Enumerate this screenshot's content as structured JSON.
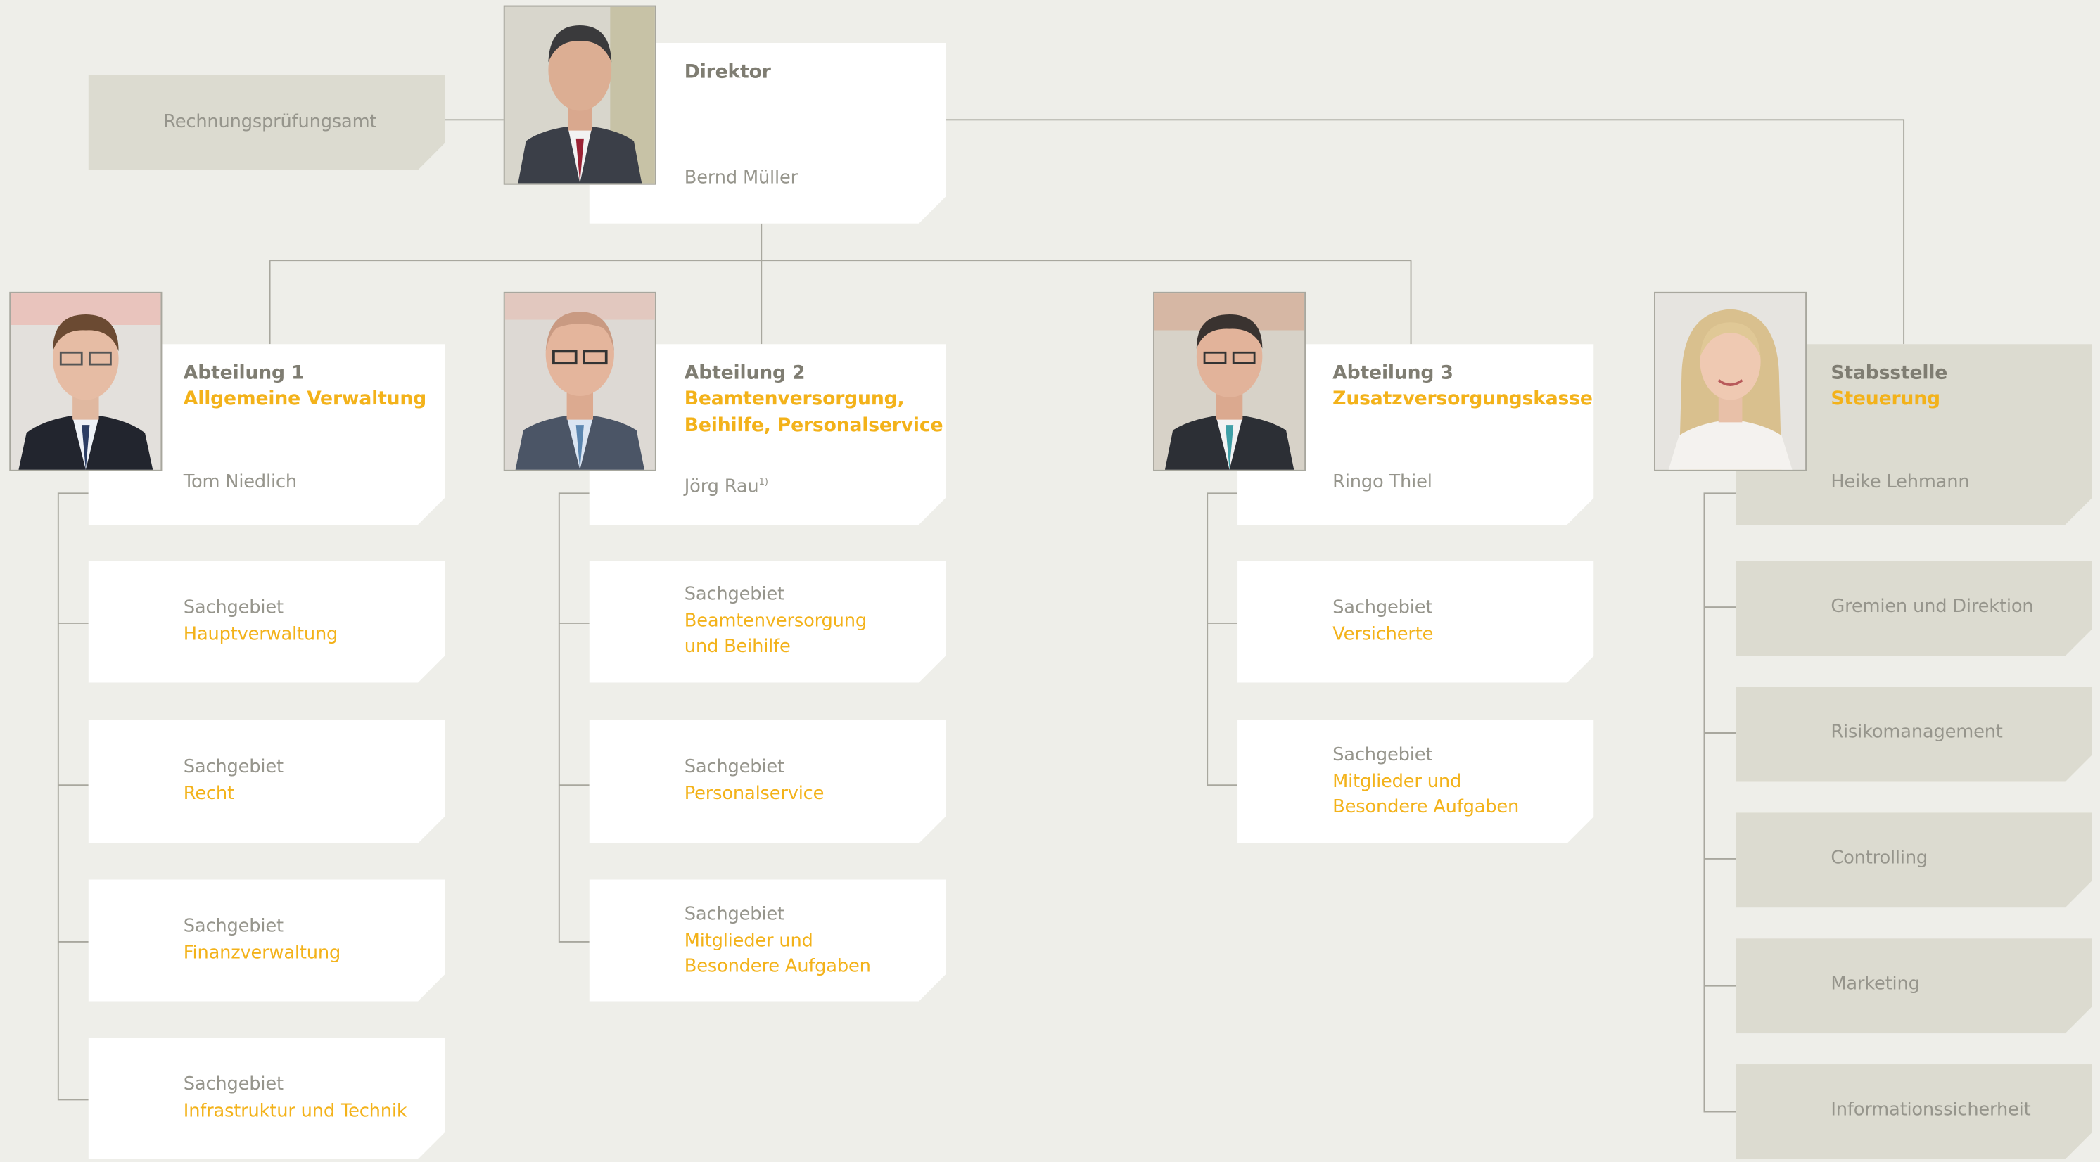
{
  "audit": {
    "label": "Rechnungsprüfungsamt"
  },
  "director": {
    "title": "Direktor",
    "name": "Bernd Müller"
  },
  "departments": [
    {
      "title": "Abteilung 1",
      "subtitle_lines": [
        "Allgemeine Verwaltung"
      ],
      "name": "Tom Niedlich",
      "name_note": ""
    },
    {
      "title": "Abteilung 2",
      "subtitle_lines": [
        "Beamtenversorgung,",
        "Beihilfe, Personalservice"
      ],
      "name": "Jörg Rau",
      "name_note": "1)"
    },
    {
      "title": "Abteilung 3",
      "subtitle_lines": [
        "Zusatzversorgungskasse"
      ],
      "name": "Ringo Thiel",
      "name_note": ""
    }
  ],
  "staff": {
    "title": "Stabsstelle",
    "subtitle": "Steuerung",
    "name": "Heike Lehmann"
  },
  "dept1_sections": [
    {
      "label": "Sachgebiet",
      "lines": [
        "Hauptverwaltung"
      ]
    },
    {
      "label": "Sachgebiet",
      "lines": [
        "Recht"
      ]
    },
    {
      "label": "Sachgebiet",
      "lines": [
        "Finanzverwaltung"
      ]
    },
    {
      "label": "Sachgebiet",
      "lines": [
        "Infrastruktur und Technik"
      ]
    }
  ],
  "dept2_sections": [
    {
      "label": "Sachgebiet",
      "lines": [
        "Beamtenversorgung",
        "und Beihilfe"
      ]
    },
    {
      "label": "Sachgebiet",
      "lines": [
        "Personalservice"
      ]
    },
    {
      "label": "Sachgebiet",
      "lines": [
        "Mitglieder und",
        "Besondere Aufgaben"
      ]
    }
  ],
  "dept3_sections": [
    {
      "label": "Sachgebiet",
      "lines": [
        "Versicherte"
      ]
    },
    {
      "label": "Sachgebiet",
      "lines": [
        "Mitglieder und",
        "Besondere Aufgaben"
      ]
    }
  ],
  "staff_units": [
    "Gremien und Direktion",
    "Risikomanagement",
    "Controlling",
    "Marketing",
    "Informationssicherheit"
  ],
  "colors": {
    "background": "#eeeee9",
    "accent": "#f3b21a",
    "grey_box": "#dcdbd0",
    "line": "#a8a79e"
  }
}
